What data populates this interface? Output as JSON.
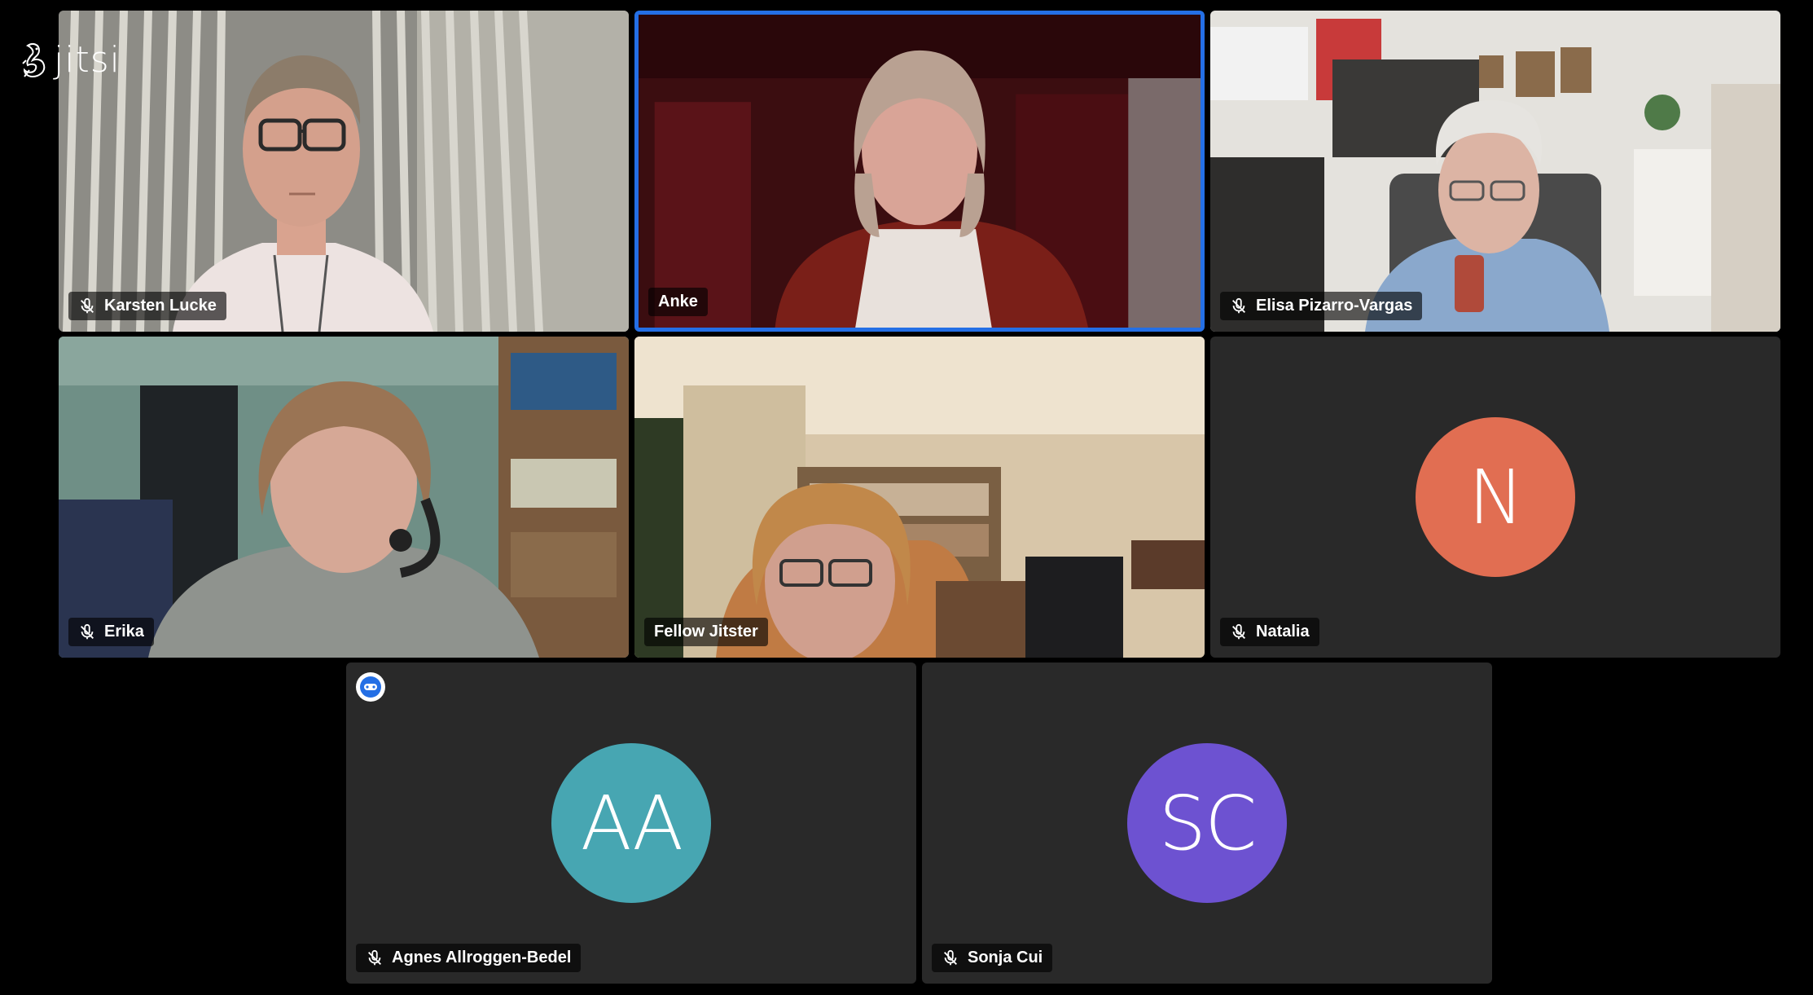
{
  "app": {
    "logo_text": "jitsi",
    "logo_icon": "jitsi-bird-icon"
  },
  "participants": [
    {
      "name": "Karsten Lucke",
      "muted": true,
      "video": true,
      "dominant": false
    },
    {
      "name": "Anke",
      "muted": false,
      "video": true,
      "dominant": true
    },
    {
      "name": "Elisa Pizarro-Vargas",
      "muted": true,
      "video": true,
      "dominant": false
    },
    {
      "name": "Erika",
      "muted": true,
      "video": true,
      "dominant": false
    },
    {
      "name": "Fellow Jitster",
      "muted": false,
      "video": true,
      "dominant": false
    },
    {
      "name": "Natalia",
      "muted": true,
      "video": false,
      "initials": "N",
      "avatar_color": "#e16e52"
    },
    {
      "name": "Agnes Allroggen-Bedel",
      "muted": true,
      "video": false,
      "initials": "AA",
      "avatar_color": "#47a6b2",
      "status_icon": "connection-status-icon"
    },
    {
      "name": "Sonja Cui",
      "muted": true,
      "video": false,
      "initials": "SC",
      "avatar_color": "#6d52d1"
    }
  ],
  "colors": {
    "background": "#000000",
    "tile_background": "#292929",
    "dominant_border": "#246fe5"
  },
  "icons": {
    "mute": "mic-muted-icon"
  }
}
